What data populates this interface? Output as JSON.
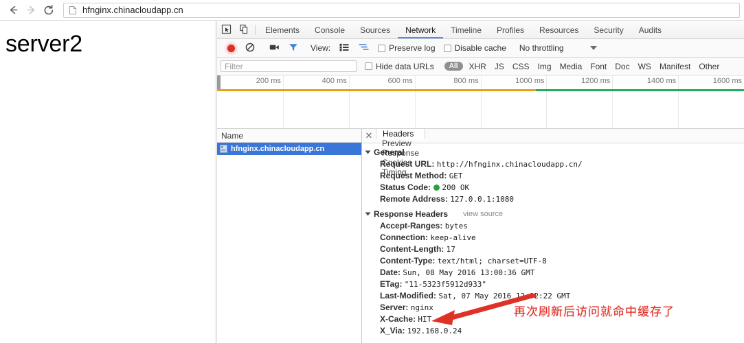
{
  "browser": {
    "back_icon": "arrow-left-icon",
    "forward_icon": "arrow-right-icon",
    "reload_icon": "reload-icon",
    "page_icon": "document-icon",
    "url": "hfnginx.chinacloudapp.cn"
  },
  "page": {
    "body_text": "server2"
  },
  "devtools": {
    "left_icons": [
      "inspect-element-icon",
      "device-toolbar-icon"
    ],
    "tabs": [
      {
        "label": "Elements",
        "active": false
      },
      {
        "label": "Console",
        "active": false
      },
      {
        "label": "Sources",
        "active": false
      },
      {
        "label": "Network",
        "active": true
      },
      {
        "label": "Timeline",
        "active": false
      },
      {
        "label": "Profiles",
        "active": false
      },
      {
        "label": "Resources",
        "active": false
      },
      {
        "label": "Security",
        "active": false
      },
      {
        "label": "Audits",
        "active": false
      }
    ],
    "controls": {
      "record_icon": "record-button-icon",
      "clear_icon": "clear-button-icon",
      "camera_icon": "screenshot-camera-icon",
      "funnel_icon": "filter-funnel-icon",
      "view_label": "View:",
      "view_list_icon": "list-view-icon",
      "view_waterfall_icon": "waterfall-view-icon",
      "preserve_log_label": "Preserve log",
      "disable_cache_label": "Disable cache",
      "throttling_value": "No throttling",
      "throttling_caret_icon": "chevron-down-icon"
    },
    "filters": {
      "filter_placeholder": "Filter",
      "hide_data_urls_label": "Hide data URLs",
      "types": [
        "All",
        "XHR",
        "JS",
        "CSS",
        "Img",
        "Media",
        "Font",
        "Doc",
        "WS",
        "Manifest",
        "Other"
      ],
      "active_type": "All"
    },
    "overview": {
      "ticks": [
        "200 ms",
        "400 ms",
        "600 ms",
        "800 ms",
        "1000 ms",
        "1200 ms",
        "1400 ms",
        "1600 ms"
      ],
      "orange_color": "#e7a118",
      "green_color": "#24ab62",
      "orange_end_pct": 60.5
    },
    "request_list": {
      "column_header": "Name",
      "rows": [
        {
          "name": "hfnginx.chinacloudapp.cn",
          "icon": "document-icon",
          "selected": true
        }
      ]
    },
    "details": {
      "close_icon": "close-icon",
      "tabs": [
        {
          "label": "Headers",
          "active": true
        },
        {
          "label": "Preview",
          "active": false
        },
        {
          "label": "Response",
          "active": false
        },
        {
          "label": "Cookies",
          "active": false
        },
        {
          "label": "Timing",
          "active": false
        }
      ],
      "general": {
        "title": "General",
        "rows": [
          {
            "name": "Request URL:",
            "value": "http://hfnginx.chinacloudapp.cn/"
          },
          {
            "name": "Request Method:",
            "value": "GET"
          },
          {
            "name": "Status Code:",
            "value": "200 OK",
            "dot": "green-status-dot"
          },
          {
            "name": "Remote Address:",
            "value": "127.0.0.1:1080"
          }
        ]
      },
      "response_headers": {
        "title": "Response Headers",
        "view_source": "view source",
        "rows": [
          {
            "name": "Accept-Ranges:",
            "value": "bytes"
          },
          {
            "name": "Connection:",
            "value": "keep-alive"
          },
          {
            "name": "Content-Length:",
            "value": "17"
          },
          {
            "name": "Content-Type:",
            "value": "text/html; charset=UTF-8"
          },
          {
            "name": "Date:",
            "value": "Sun, 08 May 2016 13:00:36 GMT"
          },
          {
            "name": "ETag:",
            "value": "\"11-5323f5912d933\""
          },
          {
            "name": "Last-Modified:",
            "value": "Sat, 07 May 2016 12:02:22 GMT"
          },
          {
            "name": "Server:",
            "value": "nginx"
          },
          {
            "name": "X-Cache:",
            "value": "HIT"
          },
          {
            "name": "X_Via:",
            "value": "192.168.0.24"
          }
        ]
      }
    }
  },
  "annotation": {
    "text": "再次刷新后访问就命中缓存了",
    "color": "#e03127",
    "arrow_icon": "red-arrow-icon"
  }
}
